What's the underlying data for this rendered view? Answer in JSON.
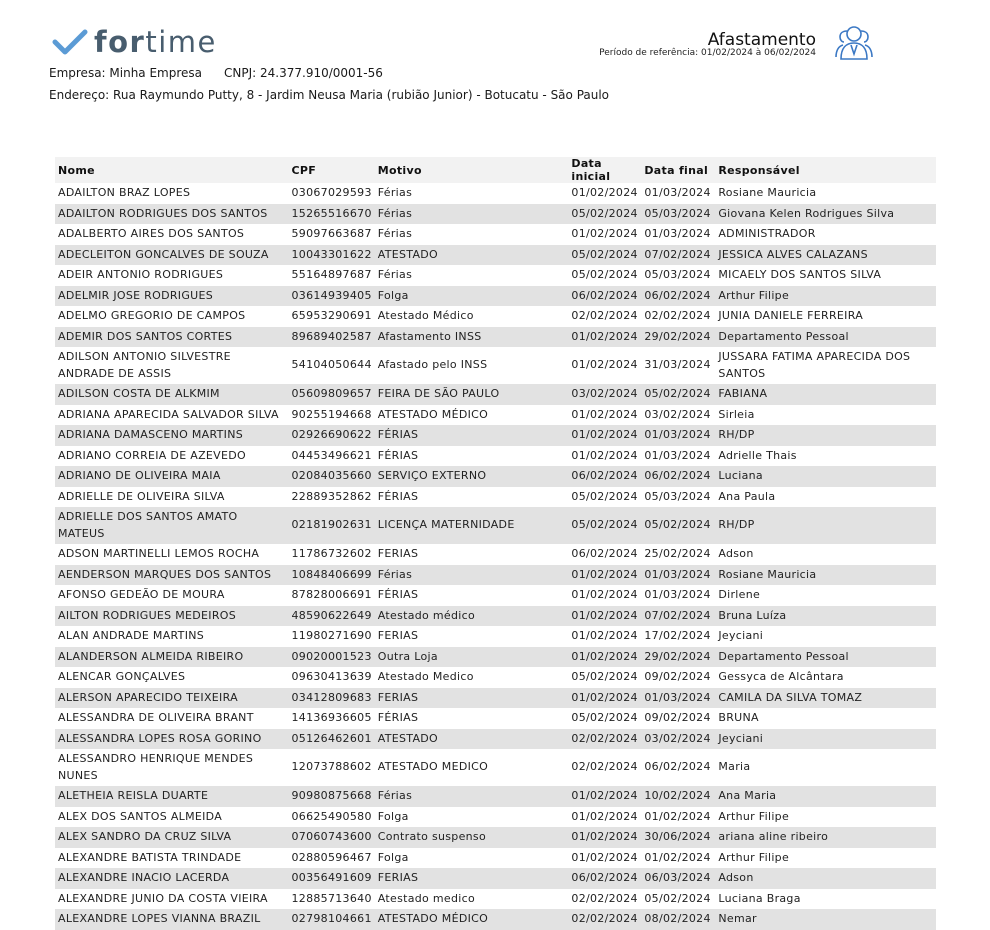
{
  "brand": {
    "check_color": "#5b9bd5",
    "text_for": "for",
    "text_time": "time"
  },
  "company": {
    "name": "Empresa: Minha Empresa",
    "cnpj": "CNPJ: 24.377.910/0001-56",
    "address": "Endereço: Rua Raymundo Putty, 8 - Jardim Neusa Maria (rubião Junior) - Botucatu - São Paulo"
  },
  "report": {
    "title": "Afastamento",
    "period": "Período de referência: 01/02/2024 à 06/02/2024",
    "icon": "people-icon",
    "icon_color": "#3b78c4"
  },
  "table": {
    "headers": [
      "Nome",
      "CPF",
      "Motivo",
      "Data inicial",
      "Data final",
      "Responsável"
    ],
    "rows": [
      [
        "ADAILTON BRAZ LOPES",
        "03067029593",
        "Férias",
        "01/02/2024",
        "01/03/2024",
        "Rosiane Mauricia"
      ],
      [
        "ADAILTON RODRIGUES DOS SANTOS",
        "15265516670",
        "Férias",
        "05/02/2024",
        "05/03/2024",
        "Giovana Kelen Rodrigues Silva"
      ],
      [
        "ADALBERTO AIRES DOS SANTOS",
        "59097663687",
        "Férias",
        "01/02/2024",
        "01/03/2024",
        "ADMINISTRADOR"
      ],
      [
        "ADECLEITON GONCALVES DE SOUZA",
        "10043301622",
        "ATESTADO",
        "05/02/2024",
        "07/02/2024",
        "JESSICA ALVES CALAZANS"
      ],
      [
        "ADEIR ANTONIO RODRIGUES",
        "55164897687",
        "Férias",
        "05/02/2024",
        "05/03/2024",
        "MICAELY DOS SANTOS SILVA"
      ],
      [
        "ADELMIR JOSE RODRIGUES",
        "03614939405",
        "Folga",
        "06/02/2024",
        "06/02/2024",
        "Arthur Filipe"
      ],
      [
        "ADELMO GREGORIO DE CAMPOS",
        "65953290691",
        "Atestado Médico",
        "02/02/2024",
        "02/02/2024",
        "JUNIA DANIELE FERREIRA"
      ],
      [
        "ADEMIR DOS SANTOS CORTES",
        "89689402587",
        "Afastamento INSS",
        "01/02/2024",
        "29/02/2024",
        "Departamento Pessoal"
      ],
      [
        "ADILSON ANTONIO SILVESTRE ANDRADE DE ASSIS",
        "54104050644",
        "Afastado pelo INSS",
        "01/02/2024",
        "31/03/2024",
        "JUSSARA FATIMA APARECIDA DOS SANTOS"
      ],
      [
        "ADILSON COSTA DE ALKMIM",
        "05609809657",
        "FEIRA DE SÃO PAULO",
        "03/02/2024",
        "05/02/2024",
        "FABIANA"
      ],
      [
        "ADRIANA APARECIDA SALVADOR SILVA",
        "90255194668",
        "ATESTADO MÉDICO",
        "01/02/2024",
        "03/02/2024",
        "Sirleia"
      ],
      [
        "ADRIANA DAMASCENO MARTINS",
        "02926690622",
        "FÉRIAS",
        "01/02/2024",
        "01/03/2024",
        "RH/DP"
      ],
      [
        "ADRIANO CORREIA DE AZEVEDO",
        "04453496621",
        "FÉRIAS",
        "01/02/2024",
        "01/03/2024",
        "Adrielle Thais"
      ],
      [
        "ADRIANO DE OLIVEIRA MAIA",
        "02084035660",
        "SERVIÇO EXTERNO",
        "06/02/2024",
        "06/02/2024",
        "Luciana"
      ],
      [
        "ADRIELLE DE OLIVEIRA SILVA",
        "22889352862",
        "FÉRIAS",
        "05/02/2024",
        "05/03/2024",
        "Ana Paula"
      ],
      [
        "ADRIELLE DOS SANTOS AMATO MATEUS",
        "02181902631",
        "LICENÇA MATERNIDADE",
        "05/02/2024",
        "05/02/2024",
        "RH/DP"
      ],
      [
        "ADSON MARTINELLI LEMOS ROCHA",
        "11786732602",
        "FERIAS",
        "06/02/2024",
        "25/02/2024",
        "Adson"
      ],
      [
        "AENDERSON MARQUES DOS SANTOS",
        "10848406699",
        "Férias",
        "01/02/2024",
        "01/03/2024",
        "Rosiane Mauricia"
      ],
      [
        "AFONSO GEDEÃO DE MOURA",
        "87828006691",
        "FÉRIAS",
        "01/02/2024",
        "01/03/2024",
        "Dirlene"
      ],
      [
        "AILTON RODRIGUES MEDEIROS",
        "48590622649",
        "Atestado médico",
        "01/02/2024",
        "07/02/2024",
        "Bruna Luíza"
      ],
      [
        "ALAN ANDRADE MARTINS",
        "11980271690",
        "FERIAS",
        "01/02/2024",
        "17/02/2024",
        "Jeyciani"
      ],
      [
        "ALANDERSON ALMEIDA RIBEIRO",
        "09020001523",
        "Outra Loja",
        "01/02/2024",
        "29/02/2024",
        "Departamento Pessoal"
      ],
      [
        "ALENCAR GONÇALVES",
        "09630413639",
        "Atestado Medico",
        "05/02/2024",
        "09/02/2024",
        "Gessyca de Alcântara"
      ],
      [
        "ALERSON APARECIDO TEIXEIRA",
        "03412809683",
        "FERIAS",
        "01/02/2024",
        "01/03/2024",
        "CAMILA DA SILVA TOMAZ"
      ],
      [
        "ALESSANDRA DE OLIVEIRA BRANT",
        "14136936605",
        "FÉRIAS",
        "05/02/2024",
        "09/02/2024",
        "BRUNA"
      ],
      [
        "ALESSANDRA LOPES ROSA GORINO",
        "05126462601",
        "ATESTADO",
        "02/02/2024",
        "03/02/2024",
        "Jeyciani"
      ],
      [
        "ALESSANDRO HENRIQUE MENDES NUNES",
        "12073788602",
        "ATESTADO MEDICO",
        "02/02/2024",
        "06/02/2024",
        "Maria"
      ],
      [
        "ALETHEIA REISLA DUARTE",
        "90980875668",
        "Férias",
        "01/02/2024",
        "10/02/2024",
        "Ana Maria"
      ],
      [
        "ALEX DOS SANTOS ALMEIDA",
        "06625490580",
        "Folga",
        "01/02/2024",
        "01/02/2024",
        "Arthur Filipe"
      ],
      [
        "ALEX SANDRO DA CRUZ SILVA",
        "07060743600",
        "Contrato suspenso",
        "01/02/2024",
        "30/06/2024",
        "ariana aline ribeiro"
      ],
      [
        "ALEXANDRE BATISTA TRINDADE",
        "02880596467",
        "Folga",
        "01/02/2024",
        "01/02/2024",
        "Arthur Filipe"
      ],
      [
        "ALEXANDRE INACIO LACERDA",
        "00356491609",
        "FERIAS",
        "06/02/2024",
        "06/03/2024",
        "Adson"
      ],
      [
        "ALEXANDRE JUNIO DA COSTA VIEIRA",
        "12885713640",
        "Atestado medico",
        "02/02/2024",
        "05/02/2024",
        "Luciana Braga"
      ],
      [
        "ALEXANDRE LOPES VIANNA BRAZIL",
        "02798104661",
        "ATESTADO MÉDICO",
        "02/02/2024",
        "08/02/2024",
        "Nemar"
      ]
    ]
  }
}
